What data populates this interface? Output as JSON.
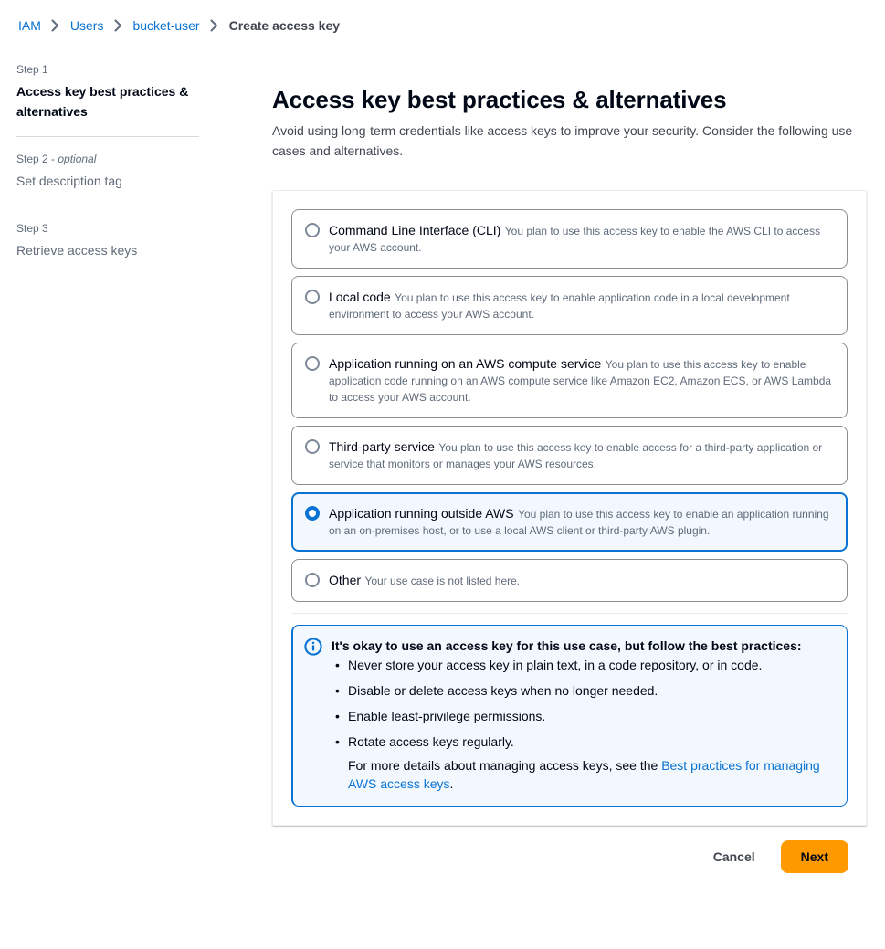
{
  "breadcrumb": {
    "items": [
      {
        "label": "IAM",
        "current": false
      },
      {
        "label": "Users",
        "current": false
      },
      {
        "label": "bucket-user",
        "current": false
      },
      {
        "label": "Create access key",
        "current": true
      }
    ]
  },
  "wizard": {
    "steps": [
      {
        "number": "Step 1",
        "optional": "",
        "title": "Access key best practices & alternatives",
        "active": true
      },
      {
        "number": "Step 2 - ",
        "optional": "optional",
        "title": "Set description tag",
        "active": false
      },
      {
        "number": "Step 3",
        "optional": "",
        "title": "Retrieve access keys",
        "active": false
      }
    ]
  },
  "main": {
    "title": "Access key best practices & alternatives",
    "description": "Avoid using long-term credentials like access keys to improve your security. Consider the following use cases and alternatives."
  },
  "use_cases": [
    {
      "label": "Command Line Interface (CLI)",
      "description": "You plan to use this access key to enable the AWS CLI to access your AWS account.",
      "selected": false
    },
    {
      "label": "Local code",
      "description": "You plan to use this access key to enable application code in a local development environment to access your AWS account.",
      "selected": false
    },
    {
      "label": "Application running on an AWS compute service",
      "description": "You plan to use this access key to enable application code running on an AWS compute service like Amazon EC2, Amazon ECS, or AWS Lambda to access your AWS account.",
      "selected": false
    },
    {
      "label": "Third-party service",
      "description": "You plan to use this access key to enable access for a third-party application or service that monitors or manages your AWS resources.",
      "selected": false
    },
    {
      "label": "Application running outside AWS",
      "description": "You plan to use this access key to enable an application running on an on-premises host, or to use a local AWS client or third-party AWS plugin.",
      "selected": true
    },
    {
      "label": "Other",
      "description": "Your use case is not listed here.",
      "selected": false
    }
  ],
  "alert": {
    "icon": "info-icon",
    "title": "It's okay to use an access key for this use case, but follow the best practices:",
    "bullets": [
      "Never store your access key in plain text, in a code repository, or in code.",
      "Disable or delete access keys when no longer needed.",
      "Enable least-privilege permissions.",
      "Rotate access keys regularly."
    ],
    "note_prefix": "For more details about managing access keys, see the ",
    "link_text": "Best practices for managing AWS access keys",
    "note_suffix": "."
  },
  "footer": {
    "cancel_label": "Cancel",
    "next_label": "Next"
  },
  "colors": {
    "link": "#0972d3",
    "accent_orange": "#ff9900",
    "selected_bg": "#f2f8fd",
    "border": "#8c8c94"
  }
}
